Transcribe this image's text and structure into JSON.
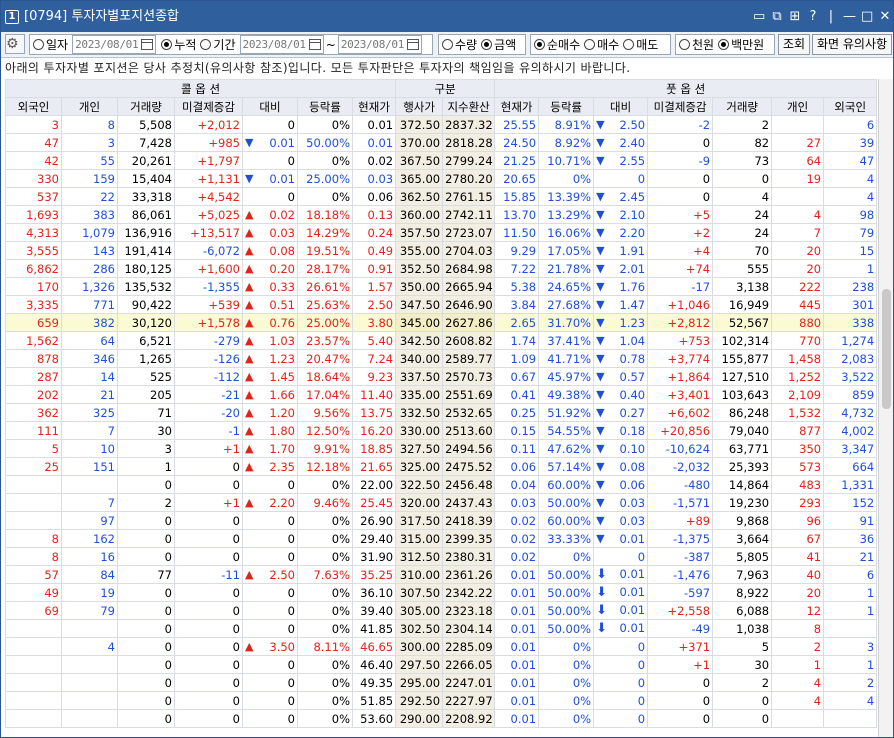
{
  "window": {
    "number": "1",
    "title": "[0794] 투자자별포지션종합",
    "controls": [
      "▭",
      "⧉",
      "⊞",
      "?",
      "|",
      "—",
      "□",
      "✕"
    ]
  },
  "toolbar": {
    "r1": "일자",
    "d1": "2023/08/01",
    "r2": "누적",
    "r3": "기간",
    "d2": "2023/08/01",
    "tilde": "~",
    "d3": "2023/08/01",
    "g1a": "수량",
    "g1b": "금액",
    "g2a": "순매수",
    "g2b": "매수",
    "g2c": "매도",
    "g3a": "천원",
    "g3b": "백만원",
    "search": "조회",
    "notice_btn": "화면 유의사항"
  },
  "notice": "아래의 투자자별 포지션은 당사 추정치(유의사항 참조)입니다. 모든 투자판단은 투자자의 책임임을 유의하시기 바랍니다.",
  "headers": {
    "call": "콜 옵 션",
    "gubun": "구분",
    "put": "풋 옵 션",
    "cols": [
      "외국인",
      "개인",
      "거래량",
      "미결제증감",
      "대비",
      "등락률",
      "현재가",
      "행사가",
      "지수환산",
      "현재가",
      "등락률",
      "대비",
      "미결제증감",
      "거래량",
      "개인",
      "외국인"
    ]
  },
  "rows": [
    [
      "3",
      "8",
      "5,508",
      "+2,012",
      "",
      "0",
      "0%",
      "0.01",
      "372.50",
      "2837.32",
      "25.55",
      "8.91%",
      "d",
      "2.50",
      "-2",
      "2",
      "",
      "6"
    ],
    [
      "47",
      "3",
      "7,428",
      "+985",
      "d",
      "0.01",
      "50.00%",
      "0.01",
      "370.00",
      "2818.28",
      "24.50",
      "8.92%",
      "d",
      "2.40",
      "0",
      "82",
      "27",
      "39"
    ],
    [
      "42",
      "55",
      "20,261",
      "+1,797",
      "",
      "0",
      "0%",
      "0.02",
      "367.50",
      "2799.24",
      "21.25",
      "10.71%",
      "d",
      "2.55",
      "-9",
      "73",
      "64",
      "47"
    ],
    [
      "330",
      "159",
      "15,404",
      "+1,131",
      "d",
      "0.01",
      "25.00%",
      "0.03",
      "365.00",
      "2780.20",
      "20.65",
      "0%",
      "",
      "0",
      "0",
      "0",
      "19",
      "4"
    ],
    [
      "537",
      "22",
      "33,318",
      "+4,542",
      "",
      "0",
      "0%",
      "0.06",
      "362.50",
      "2761.15",
      "15.85",
      "13.39%",
      "d",
      "2.45",
      "0",
      "4",
      "",
      "4"
    ],
    [
      "1,693",
      "383",
      "86,061",
      "+5,025",
      "u",
      "0.02",
      "18.18%",
      "0.13",
      "360.00",
      "2742.11",
      "13.70",
      "13.29%",
      "d",
      "2.10",
      "+5",
      "24",
      "4",
      "98"
    ],
    [
      "4,313",
      "1,079",
      "136,916",
      "+13,517",
      "u",
      "0.03",
      "14.29%",
      "0.24",
      "357.50",
      "2723.07",
      "11.50",
      "16.06%",
      "d",
      "2.20",
      "+2",
      "24",
      "7",
      "79"
    ],
    [
      "3,555",
      "143",
      "191,414",
      "-6,072",
      "u",
      "0.08",
      "19.51%",
      "0.49",
      "355.00",
      "2704.03",
      "9.29",
      "17.05%",
      "d",
      "1.91",
      "+4",
      "70",
      "20",
      "15"
    ],
    [
      "6,862",
      "286",
      "180,125",
      "+1,600",
      "u",
      "0.20",
      "28.17%",
      "0.91",
      "352.50",
      "2684.98",
      "7.22",
      "21.78%",
      "d",
      "2.01",
      "+74",
      "555",
      "20",
      "1"
    ],
    [
      "170",
      "1,326",
      "135,532",
      "-1,355",
      "u",
      "0.33",
      "26.61%",
      "1.57",
      "350.00",
      "2665.94",
      "5.38",
      "24.65%",
      "d",
      "1.76",
      "-17",
      "3,138",
      "222",
      "238"
    ],
    [
      "3,335",
      "771",
      "90,422",
      "+539",
      "u",
      "0.51",
      "25.63%",
      "2.50",
      "347.50",
      "2646.90",
      "3.84",
      "27.68%",
      "d",
      "1.47",
      "+1,046",
      "16,949",
      "445",
      "301"
    ],
    [
      "659",
      "382",
      "30,120",
      "+1,578",
      "u",
      "0.76",
      "25.00%",
      "3.80",
      "345.00",
      "2627.86",
      "2.65",
      "31.70%",
      "d",
      "1.23",
      "+2,812",
      "52,567",
      "880",
      "338"
    ],
    [
      "1,562",
      "64",
      "6,521",
      "-279",
      "u",
      "1.03",
      "23.57%",
      "5.40",
      "342.50",
      "2608.82",
      "1.74",
      "37.41%",
      "d",
      "1.04",
      "+753",
      "102,314",
      "770",
      "1,274"
    ],
    [
      "878",
      "346",
      "1,265",
      "-126",
      "u",
      "1.23",
      "20.47%",
      "7.24",
      "340.00",
      "2589.77",
      "1.09",
      "41.71%",
      "d",
      "0.78",
      "+3,774",
      "155,877",
      "1,458",
      "2,083"
    ],
    [
      "287",
      "14",
      "525",
      "-112",
      "u",
      "1.45",
      "18.64%",
      "9.23",
      "337.50",
      "2570.73",
      "0.67",
      "45.97%",
      "d",
      "0.57",
      "+1,864",
      "127,510",
      "1,252",
      "3,522"
    ],
    [
      "202",
      "21",
      "205",
      "-21",
      "u",
      "1.66",
      "17.04%",
      "11.40",
      "335.00",
      "2551.69",
      "0.41",
      "49.38%",
      "d",
      "0.40",
      "+3,401",
      "103,643",
      "2,109",
      "859"
    ],
    [
      "362",
      "325",
      "71",
      "-20",
      "u",
      "1.20",
      "9.56%",
      "13.75",
      "332.50",
      "2532.65",
      "0.25",
      "51.92%",
      "d",
      "0.27",
      "+6,602",
      "86,248",
      "1,532",
      "4,732"
    ],
    [
      "111",
      "7",
      "30",
      "-1",
      "u",
      "1.80",
      "12.50%",
      "16.20",
      "330.00",
      "2513.60",
      "0.15",
      "54.55%",
      "d",
      "0.18",
      "+20,856",
      "79,040",
      "877",
      "4,002"
    ],
    [
      "5",
      "10",
      "3",
      "+1",
      "u",
      "1.70",
      "9.91%",
      "18.85",
      "327.50",
      "2494.56",
      "0.11",
      "47.62%",
      "d",
      "0.10",
      "-10,624",
      "63,771",
      "350",
      "3,347"
    ],
    [
      "25",
      "151",
      "1",
      "0",
      "u",
      "2.35",
      "12.18%",
      "21.65",
      "325.00",
      "2475.52",
      "0.06",
      "57.14%",
      "d",
      "0.08",
      "-2,032",
      "25,393",
      "573",
      "664"
    ],
    [
      "",
      "",
      "0",
      "0",
      "",
      "0",
      "0%",
      "22.00",
      "322.50",
      "2456.48",
      "0.04",
      "60.00%",
      "d",
      "0.06",
      "-480",
      "14,864",
      "483",
      "1,331"
    ],
    [
      "",
      "7",
      "2",
      "+1",
      "u",
      "2.20",
      "9.46%",
      "25.45",
      "320.00",
      "2437.43",
      "0.03",
      "50.00%",
      "d",
      "0.03",
      "-1,571",
      "19,230",
      "293",
      "152"
    ],
    [
      "",
      "97",
      "0",
      "0",
      "",
      "0",
      "0%",
      "26.90",
      "317.50",
      "2418.39",
      "0.02",
      "60.00%",
      "d",
      "0.03",
      "+89",
      "9,868",
      "96",
      "91"
    ],
    [
      "8",
      "162",
      "0",
      "0",
      "",
      "0",
      "0%",
      "29.40",
      "315.00",
      "2399.35",
      "0.02",
      "33.33%",
      "d",
      "0.01",
      "-1,375",
      "3,664",
      "67",
      "36"
    ],
    [
      "8",
      "16",
      "0",
      "0",
      "",
      "0",
      "0%",
      "31.90",
      "312.50",
      "2380.31",
      "0.02",
      "0%",
      "",
      "0",
      "-387",
      "5,805",
      "41",
      "21"
    ],
    [
      "57",
      "84",
      "77",
      "-11",
      "u",
      "2.50",
      "7.63%",
      "35.25",
      "310.00",
      "2361.26",
      "0.01",
      "50.00%",
      "D",
      "0.01",
      "-1,476",
      "7,963",
      "40",
      "6"
    ],
    [
      "49",
      "19",
      "0",
      "0",
      "",
      "0",
      "0%",
      "36.10",
      "307.50",
      "2342.22",
      "0.01",
      "50.00%",
      "D",
      "0.01",
      "-597",
      "8,922",
      "20",
      "1"
    ],
    [
      "69",
      "79",
      "0",
      "0",
      "",
      "0",
      "0%",
      "39.40",
      "305.00",
      "2323.18",
      "0.01",
      "50.00%",
      "D",
      "0.01",
      "+2,558",
      "6,088",
      "12",
      "1"
    ],
    [
      "",
      "",
      "0",
      "0",
      "",
      "0",
      "0%",
      "41.85",
      "302.50",
      "2304.14",
      "0.01",
      "50.00%",
      "D",
      "0.01",
      "-49",
      "1,038",
      "8",
      ""
    ],
    [
      "",
      "4",
      "0",
      "0",
      "u",
      "3.50",
      "8.11%",
      "46.65",
      "300.00",
      "2285.09",
      "0.01",
      "0%",
      "",
      "0",
      "+371",
      "5",
      "2",
      "3"
    ],
    [
      "",
      "",
      "0",
      "0",
      "",
      "0",
      "0%",
      "46.40",
      "297.50",
      "2266.05",
      "0.01",
      "0%",
      "",
      "0",
      "+1",
      "30",
      "1",
      "1"
    ],
    [
      "",
      "",
      "0",
      "0",
      "",
      "0",
      "0%",
      "49.35",
      "295.00",
      "2247.01",
      "0.01",
      "0%",
      "",
      "0",
      "0",
      "2",
      "4",
      "2"
    ],
    [
      "",
      "",
      "0",
      "0",
      "",
      "0",
      "0%",
      "51.85",
      "292.50",
      "2227.97",
      "0.01",
      "0%",
      "",
      "0",
      "0",
      "0",
      "4",
      "4"
    ],
    [
      "",
      "",
      "0",
      "0",
      "",
      "0",
      "0%",
      "53.60",
      "290.00",
      "2208.92",
      "0.01",
      "0%",
      "",
      "0",
      "0",
      "0",
      "",
      ""
    ]
  ],
  "highlight_row": 11,
  "colors": {
    "title_bar": "#2f5f9c",
    "up": "#e2231a",
    "down": "#1f4fd8",
    "strike_bg": "#f3eee2",
    "highlight": "#fbfbd3"
  }
}
